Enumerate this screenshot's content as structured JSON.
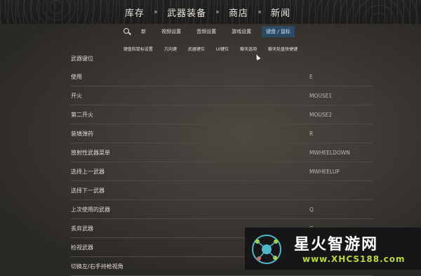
{
  "top_nav": {
    "items": [
      "库存",
      "武器装备",
      "商店",
      "新闻"
    ]
  },
  "tabs": {
    "items": [
      "新",
      "视频设置",
      "音频设置",
      "游戏设置",
      "键盘 / 鼠标"
    ],
    "active_index": 4
  },
  "subtabs": {
    "items": [
      "键盘和鼠标设置",
      "方向键",
      "武器键位",
      "UI键位",
      "聊天选项",
      "聊天轮盘快捷键"
    ]
  },
  "section": {
    "header": "武器键位",
    "rows": [
      {
        "label": "使用",
        "value": "E"
      },
      {
        "label": "开火",
        "value": "MOUSE1"
      },
      {
        "label": "第二开火",
        "value": "MOUSE2"
      },
      {
        "label": "装填弹药",
        "value": "R"
      },
      {
        "label": "放射性武器菜单",
        "value": "MWHEELDOWN"
      },
      {
        "label": "选择上一武器",
        "value": "MWHEELUP"
      },
      {
        "label": "选择下一武器",
        "value": ""
      },
      {
        "label": "上次使用的武器",
        "value": "Q"
      },
      {
        "label": "丢弃武器",
        "value": "G"
      },
      {
        "label": "检视武器",
        "value": ""
      },
      {
        "label": "切换左/右手持枪视角",
        "value": ""
      }
    ]
  },
  "watermark": {
    "title": "星火智游网",
    "url": "www.XHCS188.com"
  },
  "colors": {
    "active_tab_bg": "#2b4a63",
    "watermark_url": "#b7d93b"
  }
}
